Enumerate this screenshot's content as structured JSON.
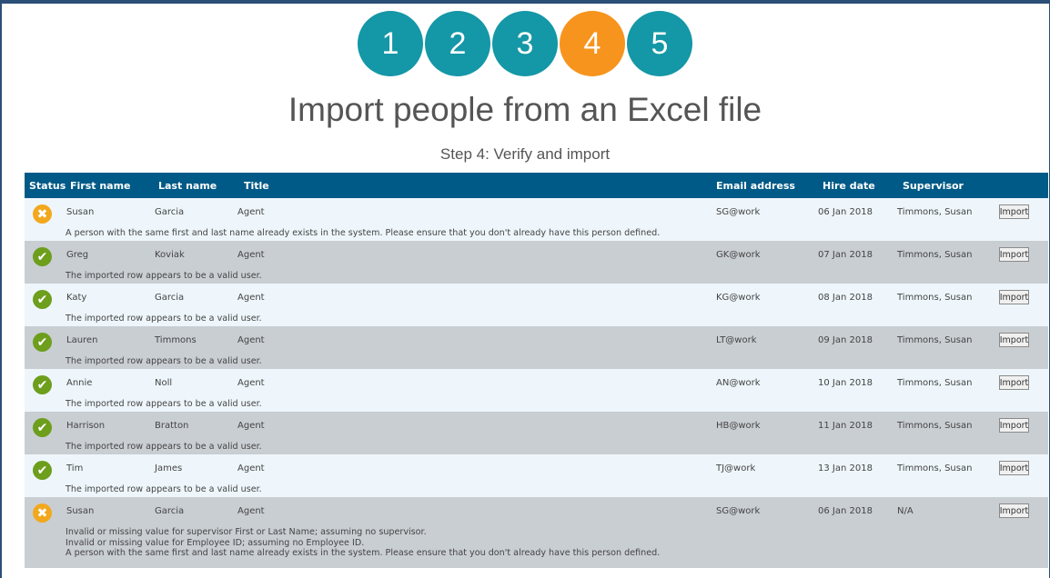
{
  "steps": [
    {
      "label": "1",
      "active": false
    },
    {
      "label": "2",
      "active": false
    },
    {
      "label": "3",
      "active": false
    },
    {
      "label": "4",
      "active": true
    },
    {
      "label": "5",
      "active": false
    }
  ],
  "title": "Import people from an Excel file",
  "subtitle": "Step 4: Verify and import",
  "columns": {
    "status": "Status",
    "first": "First name",
    "last": "Last name",
    "title": "Title",
    "email": "Email address",
    "hire": "Hire date",
    "supervisor": "Supervisor"
  },
  "import_label": "Import",
  "colors": {
    "header": "#005a87",
    "step": "#1497a6",
    "step_active": "#f7941d",
    "ok": "#6d9e1c",
    "warn": "#f2a81d"
  },
  "rows": [
    {
      "status": "warning",
      "first": "Susan",
      "last": "Garcia",
      "title": "Agent",
      "email": "SG@work",
      "hire": "06 Jan 2018",
      "supervisor": "Timmons, Susan",
      "messages": [
        "A person with the same first and last name already exists in the system. Please ensure that you don't already have this person defined."
      ]
    },
    {
      "status": "valid",
      "first": "Greg",
      "last": "Koviak",
      "title": "Agent",
      "email": "GK@work",
      "hire": "07 Jan 2018",
      "supervisor": "Timmons, Susan",
      "messages": [
        "The imported row appears to be a valid user."
      ]
    },
    {
      "status": "valid",
      "first": "Katy",
      "last": "Garcia",
      "title": "Agent",
      "email": "KG@work",
      "hire": "08 Jan 2018",
      "supervisor": "Timmons, Susan",
      "messages": [
        "The imported row appears to be a valid user."
      ]
    },
    {
      "status": "valid",
      "first": "Lauren",
      "last": "Timmons",
      "title": "Agent",
      "email": "LT@work",
      "hire": "09 Jan 2018",
      "supervisor": "Timmons, Susan",
      "messages": [
        "The imported row appears to be a valid user."
      ]
    },
    {
      "status": "valid",
      "first": "Annie",
      "last": "Noll",
      "title": "Agent",
      "email": "AN@work",
      "hire": "10 Jan 2018",
      "supervisor": "Timmons, Susan",
      "messages": [
        "The imported row appears to be a valid user."
      ]
    },
    {
      "status": "valid",
      "first": "Harrison",
      "last": "Bratton",
      "title": "Agent",
      "email": "HB@work",
      "hire": "11 Jan 2018",
      "supervisor": "Timmons, Susan",
      "messages": [
        "The imported row appears to be a valid user."
      ]
    },
    {
      "status": "valid",
      "first": "Tim",
      "last": "James",
      "title": "Agent",
      "email": "TJ@work",
      "hire": "13 Jan 2018",
      "supervisor": "Timmons, Susan",
      "messages": [
        "The imported row appears to be a valid user."
      ]
    },
    {
      "status": "warning",
      "first": "Susan",
      "last": "Garcia",
      "title": "Agent",
      "email": "SG@work",
      "hire": "06 Jan 2018",
      "supervisor": "N/A",
      "messages": [
        "Invalid or missing value for supervisor First or Last Name; assuming no supervisor.",
        "Invalid or missing value for Employee ID; assuming no Employee ID.",
        "A person with the same first and last name already exists in the system. Please ensure that you don't already have this person defined."
      ]
    }
  ]
}
